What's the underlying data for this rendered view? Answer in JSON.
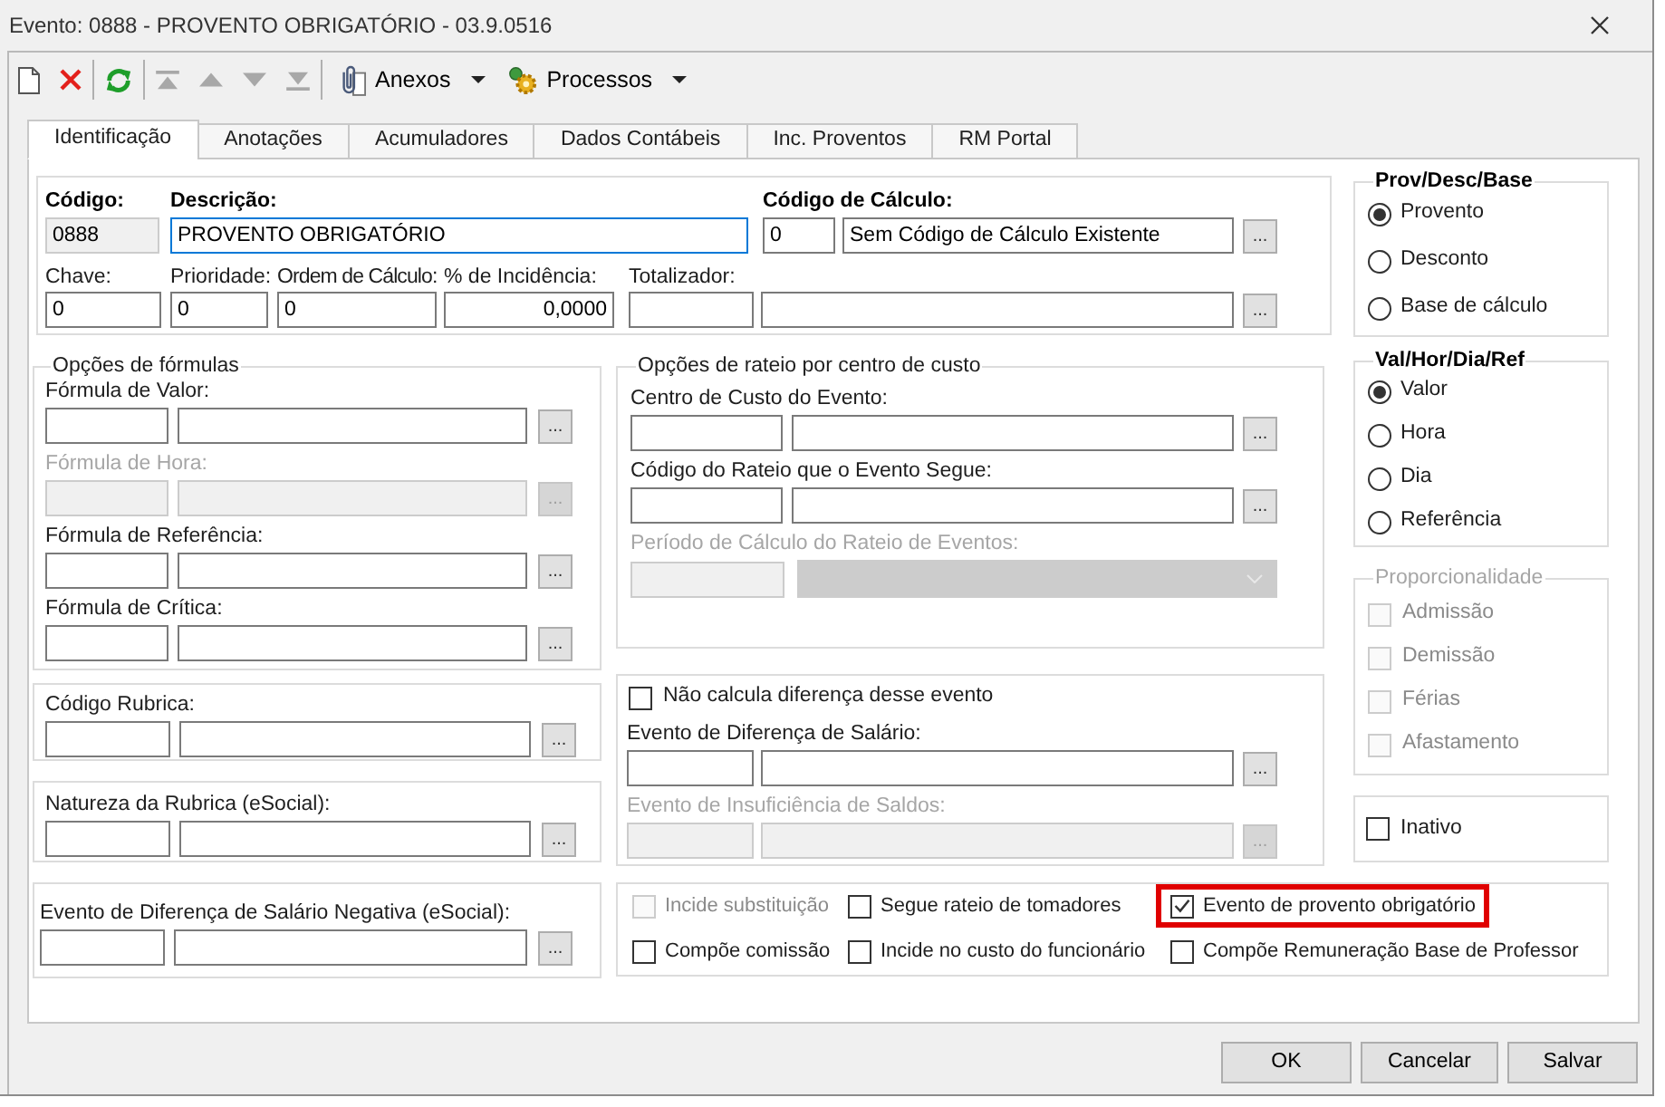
{
  "window": {
    "title": "Evento: 0888 - PROVENTO OBRIGATÓRIO - 03.9.0516"
  },
  "toolbar": {
    "groups": [
      [
        {
          "kind": "new",
          "disabled": false
        },
        {
          "kind": "delete",
          "disabled": false
        }
      ],
      [
        {
          "kind": "refresh",
          "disabled": false
        }
      ],
      [
        {
          "kind": "first",
          "disabled": true
        },
        {
          "kind": "previous",
          "disabled": true
        },
        {
          "kind": "next",
          "disabled": true
        },
        {
          "kind": "last",
          "disabled": true
        }
      ]
    ],
    "menus": [
      {
        "kind": "attachments",
        "label": "Anexos"
      },
      {
        "kind": "processes",
        "label": "Processos"
      }
    ]
  },
  "tabs": [
    {
      "label": "Identificação",
      "selected": true
    },
    {
      "label": "Anotações",
      "selected": false
    },
    {
      "label": "Acumuladores",
      "selected": false
    },
    {
      "label": "Dados Contábeis",
      "selected": false
    },
    {
      "label": "Inc. Proventos",
      "selected": false
    },
    {
      "label": "RM Portal",
      "selected": false
    }
  ],
  "header": {
    "codigo": {
      "label": "Código:",
      "value": "0888",
      "disabled": true
    },
    "descricao": {
      "label": "Descrição:",
      "value": "PROVENTO OBRIGATÓRIO",
      "focused": true
    },
    "codigo_calculo": {
      "label": "Código de Cálculo:",
      "code": "0",
      "description": "Sem Código de Cálculo Existente",
      "button": "..."
    },
    "chave": {
      "label": "Chave:",
      "value": "0"
    },
    "prioridade": {
      "label": "Prioridade:",
      "value": "0"
    },
    "ordem_calculo": {
      "label": "Ordem de Cálculo:",
      "value": "0"
    },
    "incidencia": {
      "label": "% de Incidência:",
      "value": "0,0000"
    },
    "totalizador": {
      "label": "Totalizador:",
      "button": "..."
    }
  },
  "formulas": {
    "legend": "Opções de fórmulas",
    "fields": [
      {
        "label": "Fórmula de Valor:",
        "disabled": false,
        "button": "..."
      },
      {
        "label": "Fórmula de Hora:",
        "disabled": true,
        "button": "..."
      },
      {
        "label": "Fórmula de Referência:",
        "disabled": false,
        "button": "..."
      },
      {
        "label": "Fórmula de Crítica:",
        "disabled": false,
        "button": "..."
      }
    ]
  },
  "codigo_rubrica": {
    "label": "Código Rubrica:",
    "disabled": false,
    "button": "..."
  },
  "natureza_rubrica": {
    "label": "Natureza da Rubrica (eSocial):",
    "disabled": false,
    "button": "..."
  },
  "rateio": {
    "legend": "Opções de rateio por centro de custo",
    "fields": [
      {
        "kind": "lookup",
        "label": "Centro de Custo do Evento:",
        "disabled": false,
        "button": "..."
      },
      {
        "kind": "lookup",
        "label": "Código do Rateio que o Evento Segue:",
        "disabled": false,
        "button": "..."
      },
      {
        "kind": "dropdown",
        "label": "Período de Cálculo do Rateio de Eventos:",
        "disabled": true
      }
    ]
  },
  "diferenca": {
    "checkbox": {
      "label": "Não calcula diferença desse evento",
      "checked": false
    },
    "fields": [
      {
        "label": "Evento de Diferença de Salário:",
        "disabled": false,
        "button": "..."
      },
      {
        "label": "Evento de Insuficiência de Saldos:",
        "disabled": true,
        "button": "..."
      }
    ]
  },
  "prov_desc_base": {
    "legend": "Prov/Desc/Base",
    "options": [
      {
        "label": "Provento",
        "selected": true
      },
      {
        "label": "Desconto",
        "selected": false
      },
      {
        "label": "Base de cálculo",
        "selected": false
      }
    ]
  },
  "val_hor_dia_ref": {
    "legend": "Val/Hor/Dia/Ref",
    "options": [
      {
        "label": "Valor",
        "selected": true
      },
      {
        "label": "Hora",
        "selected": false
      },
      {
        "label": "Dia",
        "selected": false
      },
      {
        "label": "Referência",
        "selected": false
      }
    ]
  },
  "proporcionalidade": {
    "legend": "Proporcionalidade",
    "disabled": true,
    "options": [
      {
        "label": "Admissão",
        "checked": false
      },
      {
        "label": "Demissão",
        "checked": false
      },
      {
        "label": "Férias",
        "checked": false
      },
      {
        "label": "Afastamento",
        "checked": false
      }
    ]
  },
  "inativo": {
    "label": "Inativo",
    "checked": false
  },
  "evento_negativo": {
    "label": "Evento de Diferença de Salário Negativa (eSocial):",
    "disabled": false,
    "button": "..."
  },
  "flags": [
    {
      "label": "Incide substituição",
      "checked": false,
      "disabled": true,
      "highlighted": false
    },
    {
      "label": "Segue rateio de tomadores",
      "checked": false,
      "disabled": false,
      "highlighted": false
    },
    {
      "label": "Evento de provento obrigatório",
      "checked": true,
      "disabled": false,
      "highlighted": true
    },
    {
      "label": "Compõe comissão",
      "checked": false,
      "disabled": false,
      "highlighted": false
    },
    {
      "label": "Incide no custo do funcionário",
      "checked": false,
      "disabled": false,
      "highlighted": false
    },
    {
      "label": "Compõe Remuneração Base de Professor",
      "checked": false,
      "disabled": false,
      "highlighted": false
    }
  ],
  "buttons": [
    {
      "label": "OK"
    },
    {
      "label": "Cancelar"
    },
    {
      "label": "Salvar"
    }
  ]
}
